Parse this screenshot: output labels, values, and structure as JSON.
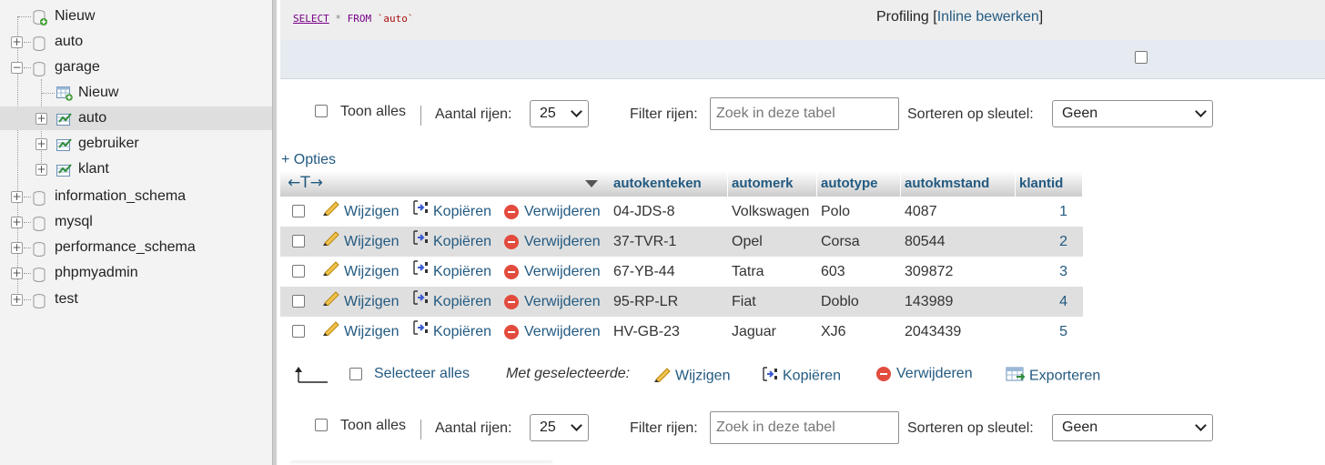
{
  "nav": {
    "new_label": "Nieuw",
    "databases": [
      {
        "name": "auto",
        "expanded": false
      },
      {
        "name": "garage",
        "expanded": true
      },
      {
        "name": "information_schema",
        "expanded": false
      },
      {
        "name": "mysql",
        "expanded": false
      },
      {
        "name": "performance_schema",
        "expanded": false
      },
      {
        "name": "phpmyadmin",
        "expanded": false
      },
      {
        "name": "test",
        "expanded": false
      }
    ],
    "garage_children": {
      "new_label": "Nieuw",
      "tables": [
        "auto",
        "gebruiker",
        "klant"
      ],
      "selected_table": "auto"
    }
  },
  "sql": {
    "select": "SELECT",
    "star": "*",
    "from": "FROM",
    "table": "`auto`"
  },
  "profiling": {
    "label": "Profiling [",
    "link": "Inline bewerken",
    "close": "]"
  },
  "navbar": {
    "show_all": "Toon alles",
    "rows_label": "Aantal rijen:",
    "rows_value": "25",
    "filter_label": "Filter rijen:",
    "filter_placeholder": "Zoek in deze tabel",
    "sort_label": "Sorteren op sleutel:",
    "sort_value": "Geen"
  },
  "options_link": "+ Opties",
  "table": {
    "columns": [
      "autokenteken",
      "automerk",
      "autotype",
      "autokmstand",
      "klantid"
    ],
    "action_labels": {
      "edit": "Wijzigen",
      "copy": "Kopiëren",
      "delete": "Verwijderen"
    },
    "rows": [
      {
        "autokenteken": "04-JDS-8",
        "automerk": "Volkswagen",
        "autotype": "Polo",
        "autokmstand": "4087",
        "klantid": "1"
      },
      {
        "autokenteken": "37-TVR-1",
        "automerk": "Opel",
        "autotype": "Corsa",
        "autokmstand": "80544",
        "klantid": "2"
      },
      {
        "autokenteken": "67-YB-44",
        "automerk": "Tatra",
        "autotype": "603",
        "autokmstand": "309872",
        "klantid": "3"
      },
      {
        "autokenteken": "95-RP-LR",
        "automerk": "Fiat",
        "autotype": "Doblo",
        "autokmstand": "143989",
        "klantid": "4"
      },
      {
        "autokenteken": "HV-GB-23",
        "automerk": "Jaguar",
        "autotype": "XJ6",
        "autokmstand": "2043439",
        "klantid": "5"
      }
    ]
  },
  "bulk": {
    "select_all": "Selecteer alles",
    "with_selected": "Met geselecteerde:",
    "edit": "Wijzigen",
    "copy": "Kopiëren",
    "delete": "Verwijderen",
    "export": "Exporteren"
  },
  "colors": {
    "link": "#235a81",
    "nav_bg": "#f3f3f3",
    "row_alt": "#dfdfdf",
    "delete_icon": "#e24b3d"
  }
}
